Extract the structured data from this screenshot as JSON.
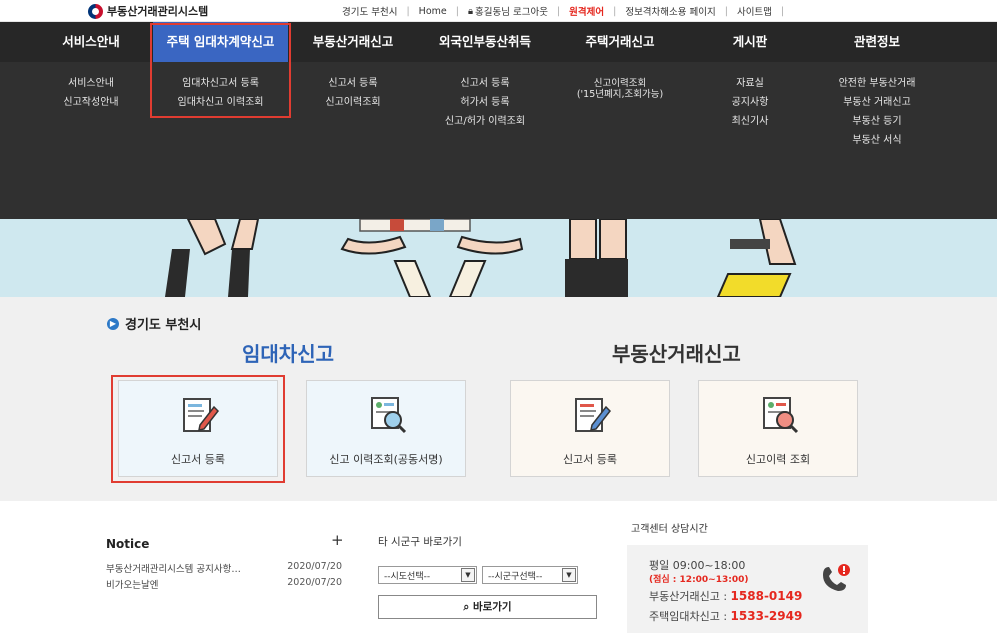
{
  "topbar": {
    "logo": "부동산거래관리시스템",
    "links": [
      "경기도 부천시",
      "Home",
      "홍길동님 로그아웃",
      "원격제어",
      "정보격차해소용 페이지",
      "사이트맵"
    ]
  },
  "nav": {
    "items": [
      "서비스안내",
      "주택 임대차계약신고",
      "부동산거래신고",
      "외국인부동산취득",
      "주택거래신고",
      "게시판",
      "관련정보"
    ],
    "active_index": 1
  },
  "submenu": {
    "col0": [
      "서비스안내",
      "신고작성안내"
    ],
    "col1": [
      "임대차신고서 등록",
      "임대차신고 이력조회"
    ],
    "col2": [
      "신고서 등록",
      "신고이력조회"
    ],
    "col3": [
      "신고서 등록",
      "허가서 등록",
      "신고/허가 이력조회"
    ],
    "col4": [
      "신고이력조회",
      "('15년폐지,조회가능)"
    ],
    "col5": [
      "자료실",
      "공지사항",
      "최신기사"
    ],
    "col6": [
      "안전한 부동산거래",
      "부동산 거래신고",
      "부동산 등기",
      "부동산 서식"
    ]
  },
  "region": "경기도 부천시",
  "categories": {
    "lease": "임대차신고",
    "trade": "부동산거래신고"
  },
  "cards": [
    {
      "label": "신고서 등록"
    },
    {
      "label": "신고 이력조회(공동서명)"
    },
    {
      "label": "신고서 등록"
    },
    {
      "label": "신고이력 조회"
    }
  ],
  "notice": {
    "title": "Notice",
    "plus": "+",
    "rows": [
      {
        "title": "부동산거래관리시스템 공지사항…",
        "date": "2020/07/20"
      },
      {
        "title": "비가오는날엔",
        "date": "2020/07/20"
      }
    ]
  },
  "goto": {
    "title": "타 시군구 바로가기",
    "sido": "--시도선택--",
    "sigungu": "--시군구선택--",
    "button": "바로가기"
  },
  "customer": {
    "title": "고객센터 상담시간",
    "hours": "평일 09:00~18:00",
    "lunch": "(점심 : 12:00~13:00)",
    "trade_label": "부동산거래신고 : ",
    "trade_num": "1588-0149",
    "lease_label": "주택임대차신고 : ",
    "lease_num": "1533-2949"
  },
  "colors": {
    "nav_bg": "#272727",
    "active": "#3a66c2",
    "highlight": "#e03c31",
    "accent_red": "#e5281f"
  }
}
